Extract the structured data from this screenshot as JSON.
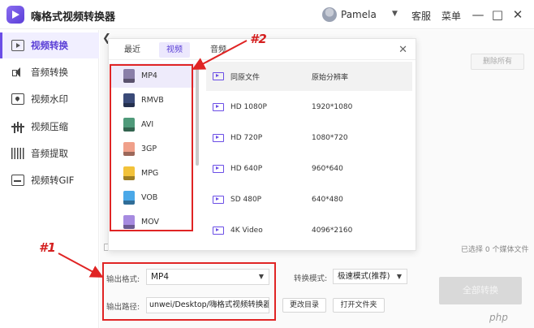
{
  "titlebar": {
    "app_title": "嗨格式视频转换器",
    "username": "Pamela",
    "links": [
      "客服",
      "菜单"
    ],
    "window_buttons": [
      "—",
      "□",
      "✕"
    ]
  },
  "sidebar": {
    "items": [
      {
        "label": "视频转换",
        "icon": "video-convert-icon",
        "active": true
      },
      {
        "label": "音频转换",
        "icon": "audio-icon"
      },
      {
        "label": "视频水印",
        "icon": "watermark-icon"
      },
      {
        "label": "视频压缩",
        "icon": "compress-icon"
      },
      {
        "label": "音频提取",
        "icon": "audio-extract-icon"
      },
      {
        "label": "视频转GIF",
        "icon": "gif-icon"
      }
    ]
  },
  "popup": {
    "tabs": [
      "最近",
      "视频",
      "音频"
    ],
    "active_tab": "视频",
    "formats": [
      {
        "label": "MP4",
        "color": "#8a7fa8",
        "active": true
      },
      {
        "label": "RMVB",
        "color": "#3a4a78"
      },
      {
        "label": "AVI",
        "color": "#4f9a7a"
      },
      {
        "label": "3GP",
        "color": "#f0a08a"
      },
      {
        "label": "MPG",
        "color": "#f2c23a"
      },
      {
        "label": "VOB",
        "color": "#4aa8e8"
      },
      {
        "label": "MOV",
        "color": "#a68ae0"
      }
    ],
    "resolutions": {
      "header": {
        "name": "同原文件",
        "size": "原始分辨率"
      },
      "rows": [
        {
          "name": "HD 1080P",
          "size": "1920*1080"
        },
        {
          "name": "HD 720P",
          "size": "1080*720"
        },
        {
          "name": "HD 640P",
          "size": "960*640"
        },
        {
          "name": "SD 480P",
          "size": "640*480"
        },
        {
          "name": "4K Video",
          "size": "4096*2160"
        }
      ]
    }
  },
  "main": {
    "clear_list": "删除所有",
    "selected_count": "已选择 0 个媒体文件"
  },
  "bottom": {
    "format_label": "输出格式:",
    "format_value": "MP4",
    "mode_label": "转换模式:",
    "mode_value": "极速模式(推荐)",
    "path_label": "输出路径:",
    "path_value": "unwei/Desktop/嗨格式视频转换器",
    "change_dir": "更改目录",
    "open_folder": "打开文件夹",
    "convert_all": "全部转换"
  },
  "annotations": {
    "label1": "#1",
    "label2": "#2",
    "color": "#e02424"
  },
  "watermark": "php"
}
